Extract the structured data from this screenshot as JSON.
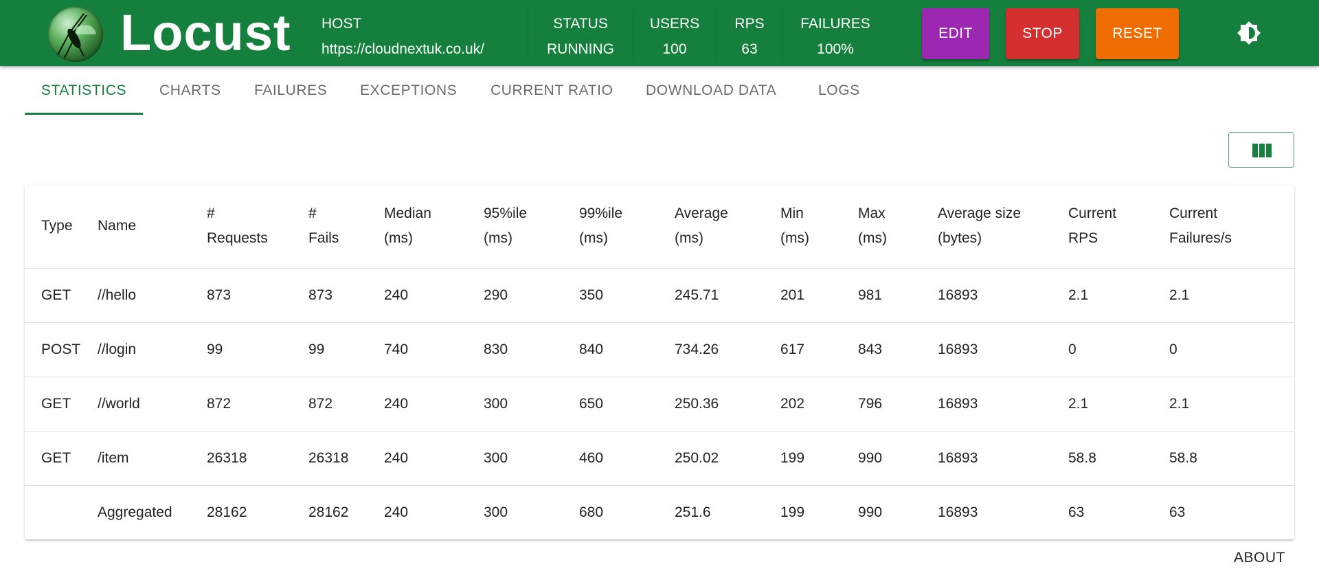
{
  "header": {
    "brand": "Locust",
    "logo_icon": "locust-logo-icon",
    "host": {
      "label": "HOST",
      "value": "https://cloudnextuk.co.uk/"
    },
    "status": {
      "label": "STATUS",
      "value": "RUNNING"
    },
    "users": {
      "label": "USERS",
      "value": "100"
    },
    "rps": {
      "label": "RPS",
      "value": "63"
    },
    "failures": {
      "label": "FAILURES",
      "value": "100%"
    },
    "buttons": {
      "edit": "EDIT",
      "stop": "STOP",
      "reset": "RESET"
    },
    "theme_icon": "brightness-icon",
    "colors": {
      "bar": "#15803d",
      "edit": "#9c27b0",
      "stop": "#d32f2f",
      "reset": "#ef6c00"
    }
  },
  "tabs": [
    "STATISTICS",
    "CHARTS",
    "FAILURES",
    "EXCEPTIONS",
    "CURRENT RATIO",
    "DOWNLOAD DATA",
    "LOGS"
  ],
  "active_tab": "STATISTICS",
  "toolbar": {
    "columns_icon": "view-column-icon"
  },
  "table": {
    "headers": [
      [
        "Type",
        ""
      ],
      [
        "Name",
        ""
      ],
      [
        "#",
        "Requests"
      ],
      [
        "#",
        "Fails"
      ],
      [
        "Median",
        "(ms)"
      ],
      [
        "95%ile",
        "(ms)"
      ],
      [
        "99%ile",
        "(ms)"
      ],
      [
        "Average",
        "(ms)"
      ],
      [
        "Min",
        "(ms)"
      ],
      [
        "Max",
        "(ms)"
      ],
      [
        "Average size",
        "(bytes)"
      ],
      [
        "Current",
        "RPS"
      ],
      [
        "Current",
        "Failures/s"
      ]
    ],
    "rows": [
      [
        "GET",
        "//hello",
        "873",
        "873",
        "240",
        "290",
        "350",
        "245.71",
        "201",
        "981",
        "16893",
        "2.1",
        "2.1"
      ],
      [
        "POST",
        "//login",
        "99",
        "99",
        "740",
        "830",
        "840",
        "734.26",
        "617",
        "843",
        "16893",
        "0",
        "0"
      ],
      [
        "GET",
        "//world",
        "872",
        "872",
        "240",
        "300",
        "650",
        "250.36",
        "202",
        "796",
        "16893",
        "2.1",
        "2.1"
      ],
      [
        "GET",
        "/item",
        "26318",
        "26318",
        "240",
        "300",
        "460",
        "250.02",
        "199",
        "990",
        "16893",
        "58.8",
        "58.8"
      ],
      [
        "",
        "Aggregated",
        "28162",
        "28162",
        "240",
        "300",
        "680",
        "251.6",
        "199",
        "990",
        "16893",
        "63",
        "63"
      ]
    ]
  },
  "footer": {
    "about": "ABOUT"
  }
}
